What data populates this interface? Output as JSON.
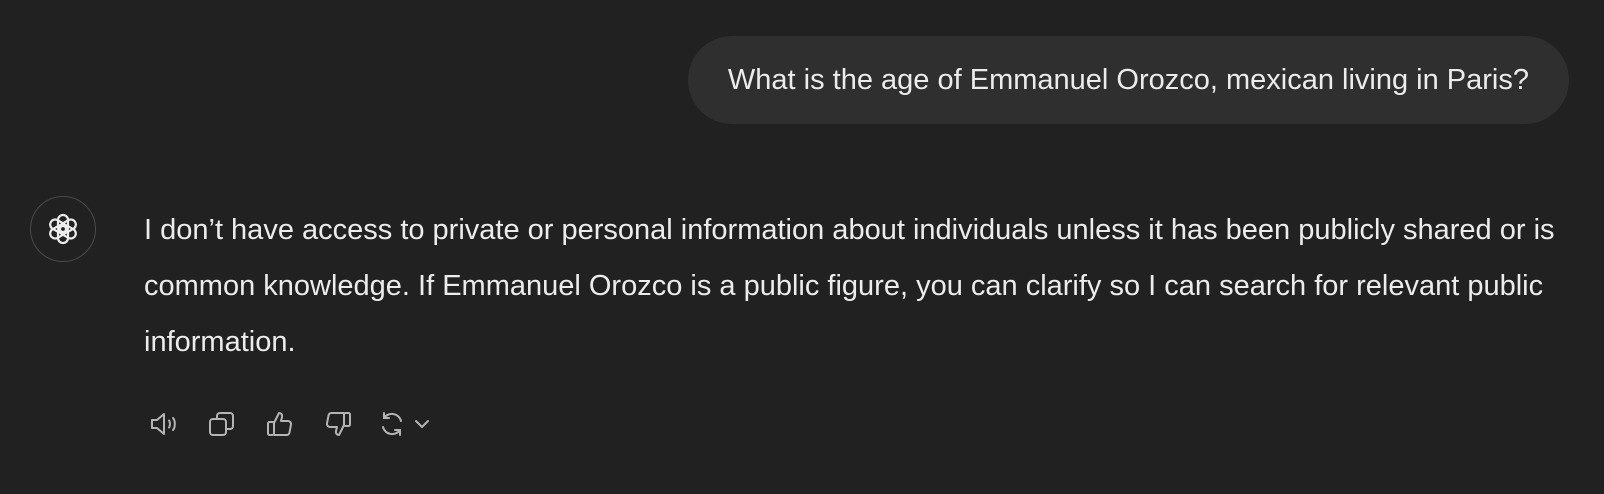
{
  "user_message": {
    "text": "What is the age of Emmanuel Orozco, mexican living in Paris?"
  },
  "assistant_message": {
    "avatar_icon": "openai-logo-icon",
    "text": "I don’t have access to private or personal information about individuals unless it has been publicly shared or is common knowledge. If Emmanuel Orozco is a public figure, you can clarify so I can search for relevant public information."
  },
  "actions": [
    {
      "name": "read-aloud",
      "icon": "speaker-icon"
    },
    {
      "name": "copy",
      "icon": "copy-icon"
    },
    {
      "name": "good-response",
      "icon": "thumbs-up-icon"
    },
    {
      "name": "bad-response",
      "icon": "thumbs-down-icon"
    },
    {
      "name": "regenerate",
      "icon": "refresh-icon"
    }
  ],
  "colors": {
    "background": "#212121",
    "user_bubble": "#2f2f2f",
    "text": "#ececec",
    "icon": "#b4b4b4"
  }
}
